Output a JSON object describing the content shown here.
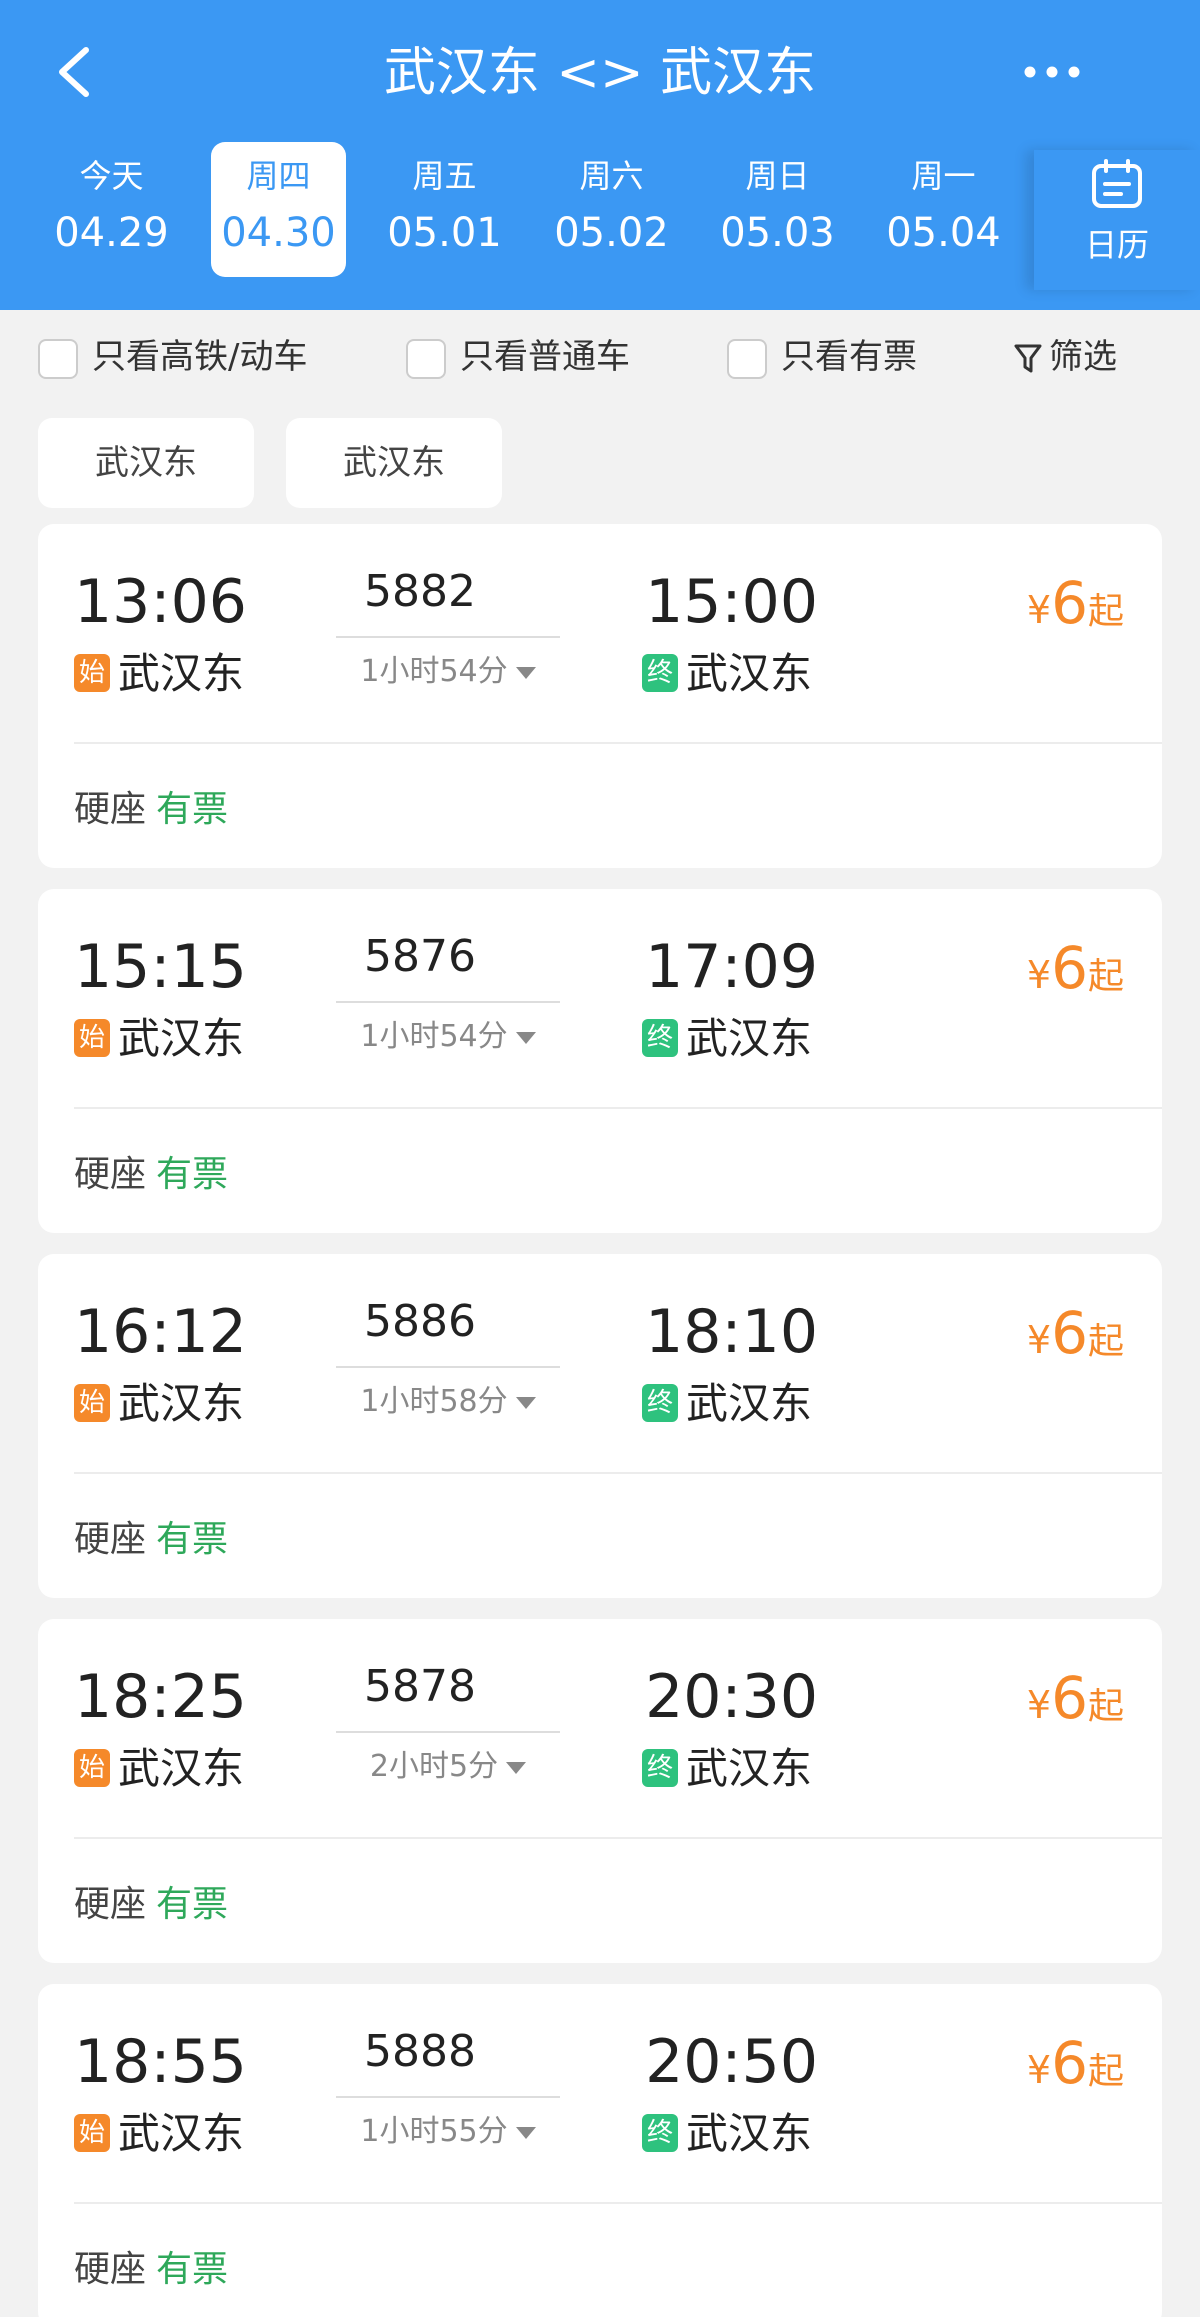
{
  "header": {
    "title": "武汉东 <> 武汉东",
    "colors": {
      "primary": "#3b98f3",
      "price": "#f5892a",
      "available": "#2ea85a"
    },
    "calendar_label": "日历"
  },
  "dates": [
    {
      "weekday": "今天",
      "date": "04.29"
    },
    {
      "weekday": "周四",
      "date": "04.30",
      "selected": true
    },
    {
      "weekday": "周五",
      "date": "05.01"
    },
    {
      "weekday": "周六",
      "date": "05.02"
    },
    {
      "weekday": "周日",
      "date": "05.03"
    },
    {
      "weekday": "周一",
      "date": "05.04"
    }
  ],
  "filters": {
    "high_speed": "只看高铁/动车",
    "normal": "只看普通车",
    "available": "只看有票",
    "filter_label": "筛选"
  },
  "chips": {
    "from": "武汉东",
    "to": "武汉东"
  },
  "trains": [
    {
      "dep_time": "13:06",
      "train_no": "5882",
      "duration": "1小时54分",
      "arr_time": "15:00",
      "from": "武汉东",
      "to": "武汉东",
      "start_tag": "始",
      "end_tag": "终",
      "currency": "¥",
      "price": "6",
      "price_suffix": "起",
      "seat": "硬座",
      "availability": "有票"
    },
    {
      "dep_time": "15:15",
      "train_no": "5876",
      "duration": "1小时54分",
      "arr_time": "17:09",
      "from": "武汉东",
      "to": "武汉东",
      "start_tag": "始",
      "end_tag": "终",
      "currency": "¥",
      "price": "6",
      "price_suffix": "起",
      "seat": "硬座",
      "availability": "有票"
    },
    {
      "dep_time": "16:12",
      "train_no": "5886",
      "duration": "1小时58分",
      "arr_time": "18:10",
      "from": "武汉东",
      "to": "武汉东",
      "start_tag": "始",
      "end_tag": "终",
      "currency": "¥",
      "price": "6",
      "price_suffix": "起",
      "seat": "硬座",
      "availability": "有票"
    },
    {
      "dep_time": "18:25",
      "train_no": "5878",
      "duration": "2小时5分",
      "arr_time": "20:30",
      "from": "武汉东",
      "to": "武汉东",
      "start_tag": "始",
      "end_tag": "终",
      "currency": "¥",
      "price": "6",
      "price_suffix": "起",
      "seat": "硬座",
      "availability": "有票"
    },
    {
      "dep_time": "18:55",
      "train_no": "5888",
      "duration": "1小时55分",
      "arr_time": "20:50",
      "from": "武汉东",
      "to": "武汉东",
      "start_tag": "始",
      "end_tag": "终",
      "currency": "¥",
      "price": "6",
      "price_suffix": "起",
      "seat": "硬座",
      "availability": "有票"
    }
  ]
}
